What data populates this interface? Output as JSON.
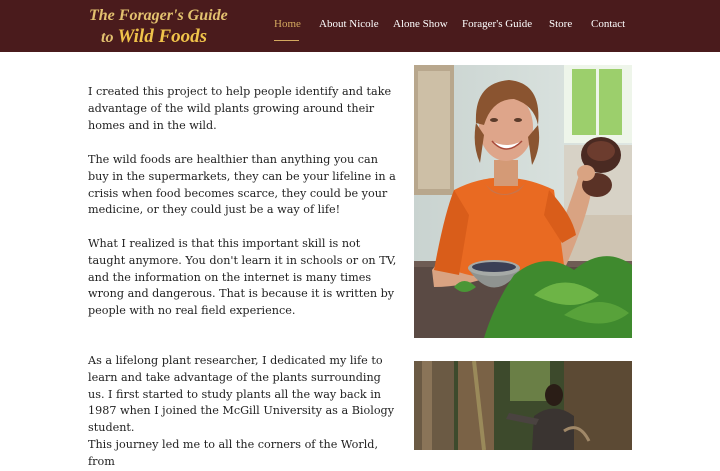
{
  "logo": {
    "line1": "The Forager's Guide",
    "line2_prefix": "to",
    "line2_emphasis": "Wild Foods"
  },
  "nav": {
    "items": [
      {
        "label": "Home",
        "active": true
      },
      {
        "label": "About Nicole"
      },
      {
        "label": "Alone Show"
      },
      {
        "label": "Forager's Guide"
      },
      {
        "label": "Store"
      },
      {
        "label": "Contact"
      }
    ]
  },
  "content": {
    "paragraphs": [
      "I created this project to help people identify and take advantage of the wild plants growing around their homes and in the wild.",
      "The wild foods are healthier than anything you can buy in the supermarkets, they can be your lifeline in a crisis when food becomes scarce, they could be your medicine, or they could just be a way of life!",
      "What I realized is that this important skill is not taught anymore. You don't learn it in schools or on TV, and the information on the internet is many times wrong and dangerous. That is because it is written by people with no real field experience.",
      "As a lifelong plant researcher, I dedicated my life to learn and take advantage of the plants surrounding us. I first started to study plants all the way back in 1987 when I joined the McGill University as a Biology student.",
      "This journey led me to all the corners of the World, from"
    ]
  },
  "colors": {
    "header_bg": "#4a1b1c",
    "logo_gold": "#e3c16f",
    "nav_active": "#d4a95f",
    "text": "#222222"
  }
}
